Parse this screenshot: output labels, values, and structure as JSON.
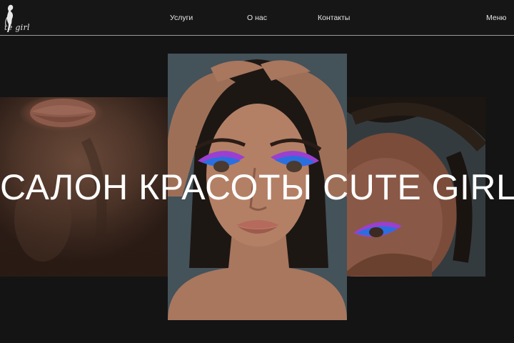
{
  "header": {
    "logo_text": "te girl",
    "nav": {
      "services": "Услуги",
      "about": "О нас",
      "contacts": "Контакты",
      "menu": "Меню"
    }
  },
  "hero": {
    "headline": "САЛОН КРАСОТЫ CUTE GIRL"
  },
  "colors": {
    "background": "#141414",
    "header_border": "#9a9a9a",
    "text": "#ffffff",
    "eyeshadow_purple": "#9b3fd0",
    "eyeshadow_blue": "#2a6fe0"
  }
}
